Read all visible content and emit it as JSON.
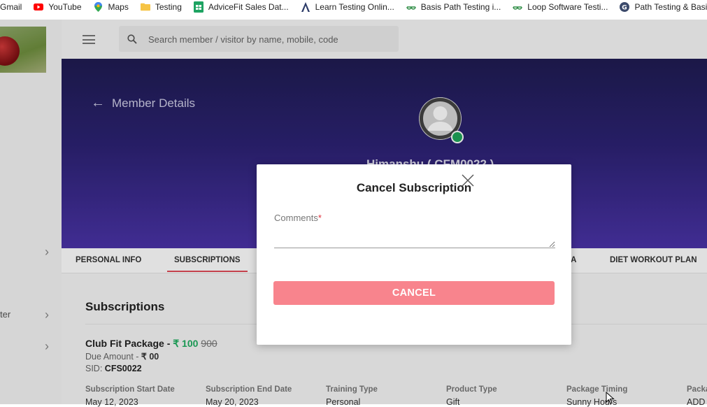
{
  "bookmarks": [
    {
      "label": "Gmail",
      "icon": "gmail-icon"
    },
    {
      "label": "YouTube",
      "icon": "youtube-icon"
    },
    {
      "label": "Maps",
      "icon": "maps-icon"
    },
    {
      "label": "Testing",
      "icon": "folder-icon"
    },
    {
      "label": "AdviceFit Sales Dat...",
      "icon": "sheets-icon"
    },
    {
      "label": "Learn Testing Onlin...",
      "icon": "learn-icon"
    },
    {
      "label": "Basis Path Testing i...",
      "icon": "gfg-icon"
    },
    {
      "label": "Loop Software Testi...",
      "icon": "gfg-icon"
    },
    {
      "label": "Path Testing & Basi...",
      "icon": "g-icon"
    }
  ],
  "sidebar": {
    "item_partial": "ter"
  },
  "search": {
    "placeholder": "Search member / visitor by name, mobile, code"
  },
  "hero": {
    "back_label": "Member Details",
    "member_name": "Himanshu ( CFM0022 )"
  },
  "tabs": [
    "PERSONAL INFO",
    "SUBSCRIPTIONS",
    "TA",
    "DIET WORKOUT PLAN"
  ],
  "content": {
    "section_title": "Subscriptions",
    "package_name": "Club Fit Package - ",
    "price": "₹ 100",
    "original_price": "900",
    "due_label": "Due Amount - ",
    "due_value": "₹ 00",
    "sid_label": "SID: ",
    "sid_value": "CFS0022",
    "fields": [
      {
        "label": "Subscription Start Date",
        "value": "May 12, 2023"
      },
      {
        "label": "Subscription End Date",
        "value": "May 20, 2023"
      },
      {
        "label": "Training Type",
        "value": "Personal"
      },
      {
        "label": "Product Type",
        "value": "Gift"
      },
      {
        "label": "Package Timing",
        "value": "Sunny Hours"
      },
      {
        "label": "Packa",
        "value": "ADD"
      }
    ]
  },
  "modal": {
    "title": "Cancel Subscription",
    "comments_label": "Comments",
    "required_mark": "*",
    "cancel_label": "CANCEL"
  },
  "colors": {
    "accent_green": "#1fae60",
    "cancel_button": "#f8848d",
    "tab_underline": "#e04a57",
    "hero_top": "#1f1c52",
    "hero_bottom": "#4a33a7",
    "status_online": "#1fa55a"
  }
}
